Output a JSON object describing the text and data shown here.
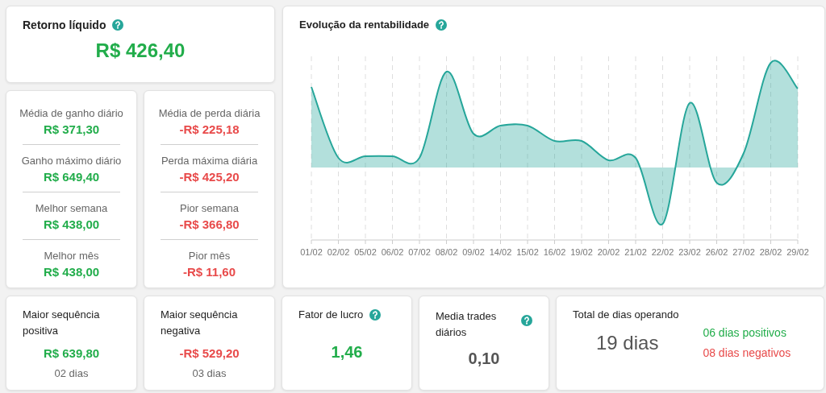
{
  "net_return": {
    "title": "Retorno líquido",
    "help": true,
    "value": "R$ 426,40",
    "color": "#22ad4b"
  },
  "gain_stats": [
    {
      "label": "Média de ganho diário",
      "value": "R$ 371,30",
      "color": "#22ad4b"
    },
    {
      "label": "Ganho máximo diário",
      "value": "R$ 649,40",
      "color": "#22ad4b"
    },
    {
      "label": "Melhor semana",
      "value": "R$ 438,00",
      "color": "#22ad4b"
    },
    {
      "label": "Melhor mês",
      "value": "R$ 438,00",
      "color": "#22ad4b"
    }
  ],
  "loss_stats": [
    {
      "label": "Média de perda diária",
      "value": "-R$ 225,18",
      "color": "#e84a4a"
    },
    {
      "label": "Perda máxima diária",
      "value": "-R$ 425,20",
      "color": "#e84a4a"
    },
    {
      "label": "Pior semana",
      "value": "-R$ 366,80",
      "color": "#e84a4a"
    },
    {
      "label": "Pior mês",
      "value": "-R$ 11,60",
      "color": "#e84a4a"
    }
  ],
  "chart": {
    "title": "Evolução da rentabilidade",
    "help": true,
    "x_labels": [
      "01/02",
      "02/02",
      "05/02",
      "06/02",
      "07/02",
      "08/02",
      "09/02",
      "14/02",
      "15/02",
      "16/02",
      "19/02",
      "20/02",
      "21/02",
      "22/02",
      "23/02",
      "26/02",
      "27/02",
      "28/02",
      "29/02"
    ]
  },
  "bottom_cards": [
    {
      "kind": "sequence",
      "title": "Maior sequência positiva",
      "value": "R$ 639,80",
      "color": "#22ad4b",
      "note": "02 dias"
    },
    {
      "kind": "sequence",
      "title": "Maior sequência negativa",
      "value": "-R$ 529,20",
      "color": "#e84a4a",
      "note": "03 dias"
    },
    {
      "kind": "metric",
      "title": "Fator de lucro",
      "help": true,
      "value": "1,46",
      "color": "#22ad4b"
    },
    {
      "kind": "metric_side_help",
      "title": "Media trades diários",
      "help": true,
      "value": "0,10",
      "color": "#555555"
    },
    {
      "kind": "days",
      "title": "Total de dias operando",
      "value": "19 dias",
      "positive": "06 dias positivos",
      "negative": "08 dias negativos"
    }
  ]
}
